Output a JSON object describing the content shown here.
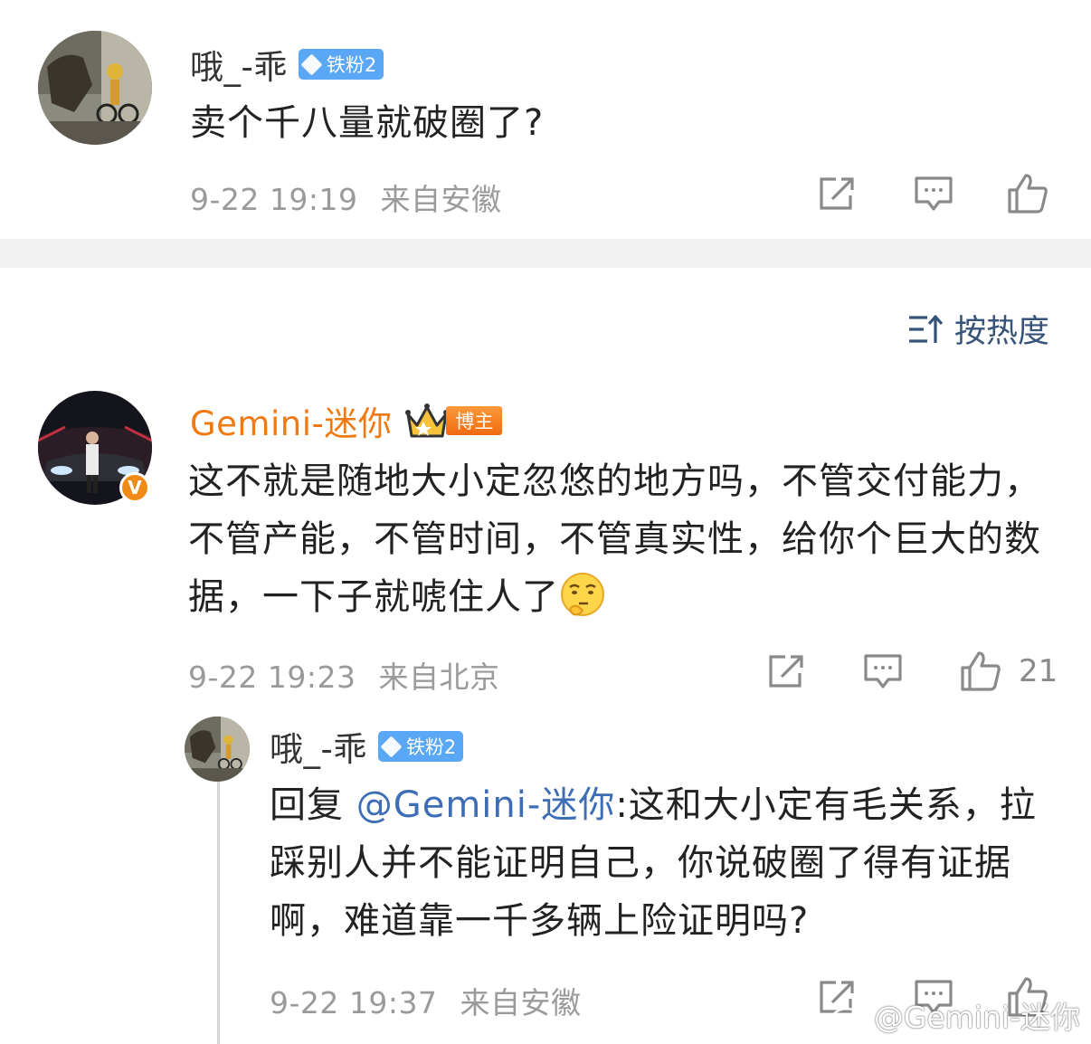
{
  "comments": [
    {
      "username": "哦_-乖",
      "badge": "铁粉2",
      "text": "卖个千八量就破圈了?",
      "time": "9-22 19:19",
      "location": "来自安徽"
    },
    {
      "username": "Gemini-迷你",
      "badge": "博主",
      "verified_mark": "V",
      "text": "这不就是随地大小定忽悠的地方吗，不管交付能力，不管产能，不管时间，不管真实性，给你个巨大的数据，一下子就唬住人了",
      "emoji": "thinking-face-emoji",
      "time": "9-22 19:23",
      "location": "来自北京",
      "likes": "21"
    }
  ],
  "reply": {
    "username": "哦_-乖",
    "badge": "铁粉2",
    "prefix": "回复 ",
    "mention": "@Gemini-迷你",
    "text": ":这和大小定有毛关系，拉踩别人并不能证明自己，你说破圈了得有证据啊，难道靠一千多辆上险证明吗?",
    "time": "9-22 19:37",
    "location": "来自安徽"
  },
  "sort": {
    "label": "按热度",
    "icon": "sort-icon"
  },
  "watermark": "@Gemini-迷你",
  "colors": {
    "blogger_name": "#f07a12",
    "fan_badge": "#5aa7f5",
    "mention": "#3d6db5",
    "sort": "#36537a",
    "meta": "#9a9a9a",
    "separator": "#f2f2f2"
  }
}
